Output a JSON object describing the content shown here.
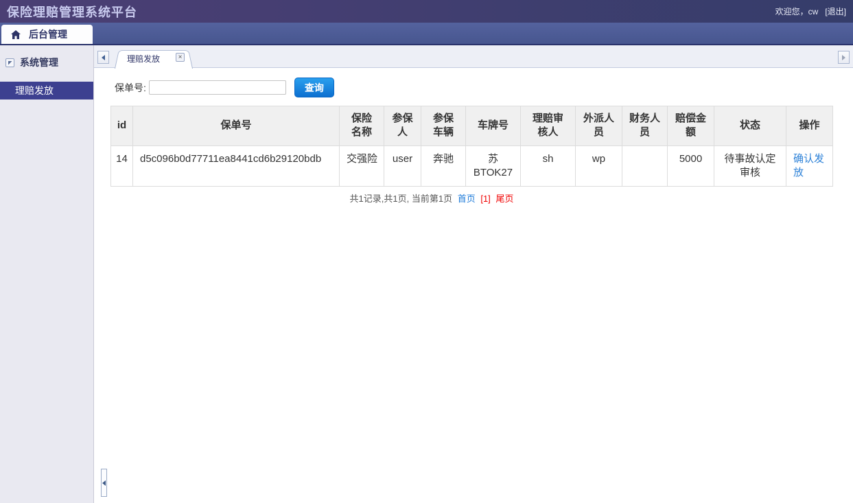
{
  "header": {
    "title": "保险理赔管理系统平台",
    "welcome_text": "欢迎您，cw",
    "logout_label": "[退出]",
    "nav_tab_label": "后台管理"
  },
  "sidebar": {
    "section_label": "系统管理",
    "items": [
      {
        "label": "理赔发放",
        "selected": true
      }
    ]
  },
  "content": {
    "tab_label": "理赔发放",
    "tab_close_glyph": "×",
    "search": {
      "label": "保单号:",
      "input_value": "",
      "button_label": "查询"
    },
    "table": {
      "columns": [
        "id",
        "保单号",
        "保险名称",
        "参保人",
        "参保车辆",
        "车牌号",
        "理赔审核人",
        "外派人员",
        "财务人员",
        "赔偿金额",
        "状态",
        "操作"
      ],
      "rows": [
        {
          "id": "14",
          "policy_no": "d5c096b0d77711ea8441cd6b29120bdb",
          "insurance_name": "交强险",
          "insured_person": "user",
          "insured_vehicle": "奔驰",
          "plate_no": "苏BTOK27",
          "claim_auditor": "sh",
          "dispatched_staff": "wp",
          "finance_staff": "",
          "compensation_amount": "5000",
          "status": "待事故认定审核",
          "action_label": "确认发放"
        }
      ]
    },
    "pagination": {
      "summary": "共1记录,共1页, 当前第1页",
      "first_label": "首页",
      "current_label": "[1]",
      "last_label": "尾页"
    }
  },
  "icons": {
    "home": "home-icon",
    "collapse_section": "collapse-icon",
    "tab_scroll_left": "chevron-left-icon",
    "tab_scroll_right": "chevron-right-icon",
    "tab_close": "close-icon",
    "sidebar_collapse_handle": "chevron-left-icon"
  },
  "colors": {
    "header_purple": "#4b3f74",
    "header_navy": "#353d6a",
    "navbar_blue": "#4c5b99",
    "selected_item_bg": "#3d4090",
    "button_blue": "#0c6fd0",
    "link_blue": "#1e7bd9",
    "link_red": "#f00000",
    "table_header_bg": "#f0f0f0",
    "sidebar_bg": "#e9e9f1"
  }
}
